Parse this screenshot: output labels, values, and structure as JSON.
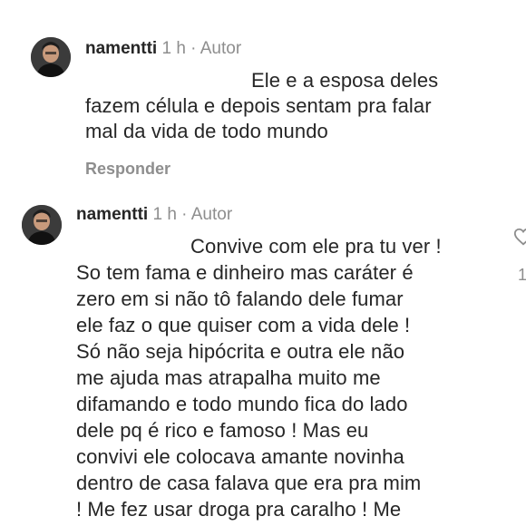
{
  "comments": [
    {
      "username": "namentti",
      "time": "1 h",
      "separator": "·",
      "badge": "Autor",
      "lines": [
        "Ele e a esposa deles",
        "fazem célula e depois sentam pra falar",
        "mal da vida de todo mundo"
      ],
      "reply_label": "Responder"
    },
    {
      "username": "namentti",
      "time": "1 h",
      "separator": "·",
      "badge": "Autor",
      "lines": [
        "Convive com ele pra tu ver !",
        "So tem fama e dinheiro mas caráter é",
        "zero em si não tô falando dele fumar",
        "ele faz o que quiser com a vida dele !",
        "Só não seja hipócrita e outra ele não",
        "me ajuda mas atrapalha muito me",
        "difamando e todo mundo fica do lado",
        "dele pq é rico e famoso ! Mas eu",
        "convivi ele colocava amante novinha",
        "dentro de casa falava que era pra mim",
        "! Me fez usar droga pra caralho ! Me"
      ],
      "like_count": "1"
    }
  ],
  "icons": {
    "like": "heart-icon"
  }
}
